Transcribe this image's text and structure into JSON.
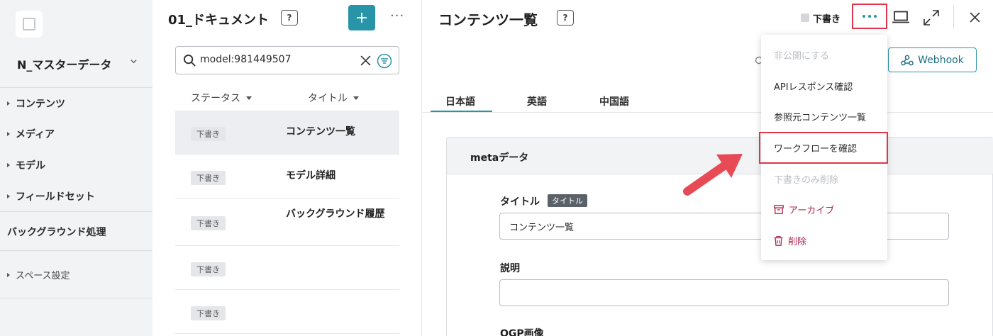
{
  "sidebar": {
    "space_name": "N_マスターデータ",
    "items": [
      {
        "label": "コンテンツ"
      },
      {
        "label": "メディア"
      },
      {
        "label": "モデル"
      },
      {
        "label": "フィールドセット"
      }
    ],
    "background": "バックグラウンド処理",
    "space_settings": "スペース設定"
  },
  "list": {
    "folder_title": "01_ドキュメント",
    "help_label": "?",
    "add_label": "+",
    "more_label": "···",
    "search_value": "model:981449507",
    "columns": {
      "status": "ステータス",
      "title": "タイトル"
    },
    "rows": [
      {
        "status": "下書き",
        "title": "コンテンツ一覧"
      },
      {
        "status": "下書き",
        "title": "モデル詳細"
      },
      {
        "status": "下書き",
        "title": "バックグラウンド履歴"
      },
      {
        "status": "下書き",
        "title": ""
      },
      {
        "status": "下書き",
        "title": ""
      }
    ]
  },
  "detail": {
    "title": "コンテンツ一覧",
    "help_label": "?",
    "status": "下書き",
    "webhook_label": "Webhook",
    "tabs": [
      {
        "label": "日本語"
      },
      {
        "label": "英語"
      },
      {
        "label": "中国語"
      }
    ],
    "section_title": "metaデータ",
    "fields": {
      "title_label": "タイトル",
      "title_tag": "タイトル",
      "title_value": "コンテンツ一覧",
      "description_label": "説明",
      "description_value": "",
      "ogp_label": "OGP画像"
    }
  },
  "menu": {
    "items": [
      {
        "label": "非公開にする",
        "state": "disabled"
      },
      {
        "label": "APIレスポンス確認",
        "state": "normal"
      },
      {
        "label": "参照元コンテンツ一覧",
        "state": "normal"
      },
      {
        "label": "ワークフローを確認",
        "state": "highlighted"
      },
      {
        "label": "下書きのみ削除",
        "state": "disabled"
      },
      {
        "label": "アーカイブ",
        "state": "danger",
        "icon": "archive-icon"
      },
      {
        "label": "削除",
        "state": "danger",
        "icon": "trash-icon"
      }
    ]
  },
  "colors": {
    "accent": "#2894a8",
    "highlight": "#e0344a",
    "danger": "#b0244a",
    "sidebar_bg": "#f2f3f5"
  }
}
